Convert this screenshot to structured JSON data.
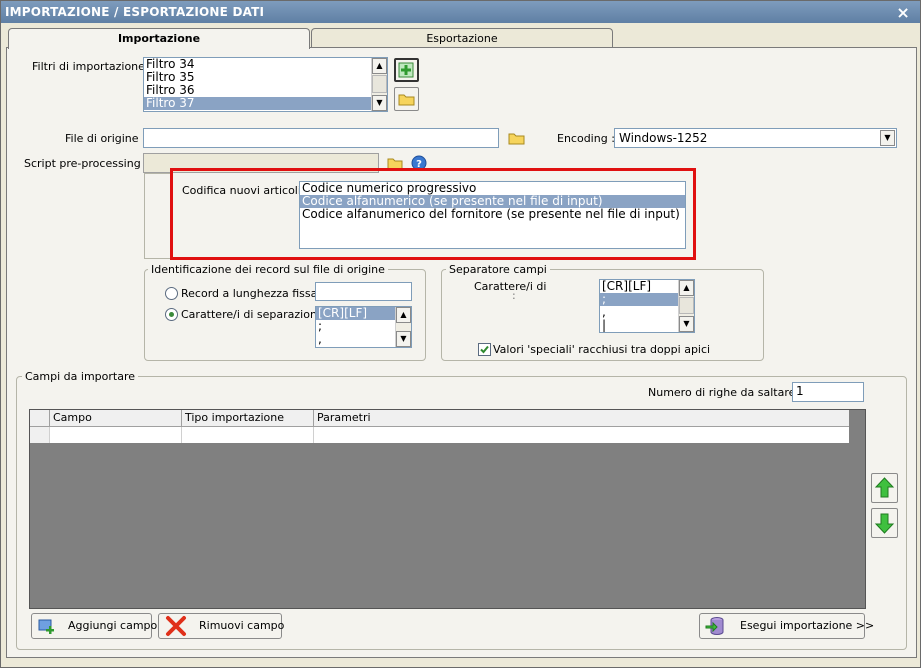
{
  "window": {
    "title": "IMPORTAZIONE / ESPORTAZIONE DATI",
    "close_glyph": "×"
  },
  "tabs": [
    {
      "label": "Importazione"
    },
    {
      "label": "Esportazione"
    }
  ],
  "filters": {
    "label": "Filtri di importazione :",
    "items": [
      "Filtro 34",
      "Filtro 35",
      "Filtro 36",
      "Filtro 37"
    ],
    "selected": "Filtro 37"
  },
  "file": {
    "origin_label": "File di origine :",
    "origin_value": "",
    "encoding_label": "Encoding :",
    "encoding_value": "Windows-1252",
    "script_label": "Script pre-processing :",
    "script_value": ""
  },
  "codifica": {
    "label": "Codifica nuovi articoli :",
    "items": [
      "Codice numerico progressivo",
      "Codice alfanumerico (se presente nel file di input)",
      "Codice alfanumerico del fornitore (se presente nel file di input)"
    ],
    "selected": "Codice alfanumerico (se presente nel file di input)"
  },
  "identificazione": {
    "title": "Identificazione dei record sul file di origine",
    "radio_fixed_label": "Record a lunghezza fissa",
    "fixed_value": "",
    "radio_sep_label": "Carattere/i di separazione",
    "sep_items": [
      "[CR][LF]",
      ";",
      ","
    ],
    "sep_selected": "[CR][LF]"
  },
  "separatore": {
    "title": "Separatore campi",
    "char_label": "Carattere/i di",
    "char_label_cont": ":",
    "items": [
      "[CR][LF]",
      ";",
      ",",
      "|"
    ],
    "selected": ";",
    "quotes_label": "Valori 'speciali' racchiusi tra doppi apici",
    "quotes_checked": true
  },
  "campi": {
    "title": "Campi da importare",
    "skip_label": "Numero di righe da saltare :",
    "skip_value": "1",
    "columns": [
      "Campo",
      "Tipo importazione",
      "Parametri"
    ]
  },
  "buttons": {
    "add_field": "Aggiungi campo",
    "remove_field": "Rimuovi campo",
    "run_import": "Esegui importazione >>"
  },
  "colors": {
    "highlight": "#e01010",
    "selection": "#8aa3c4",
    "titlebar": "#6d8db2"
  }
}
